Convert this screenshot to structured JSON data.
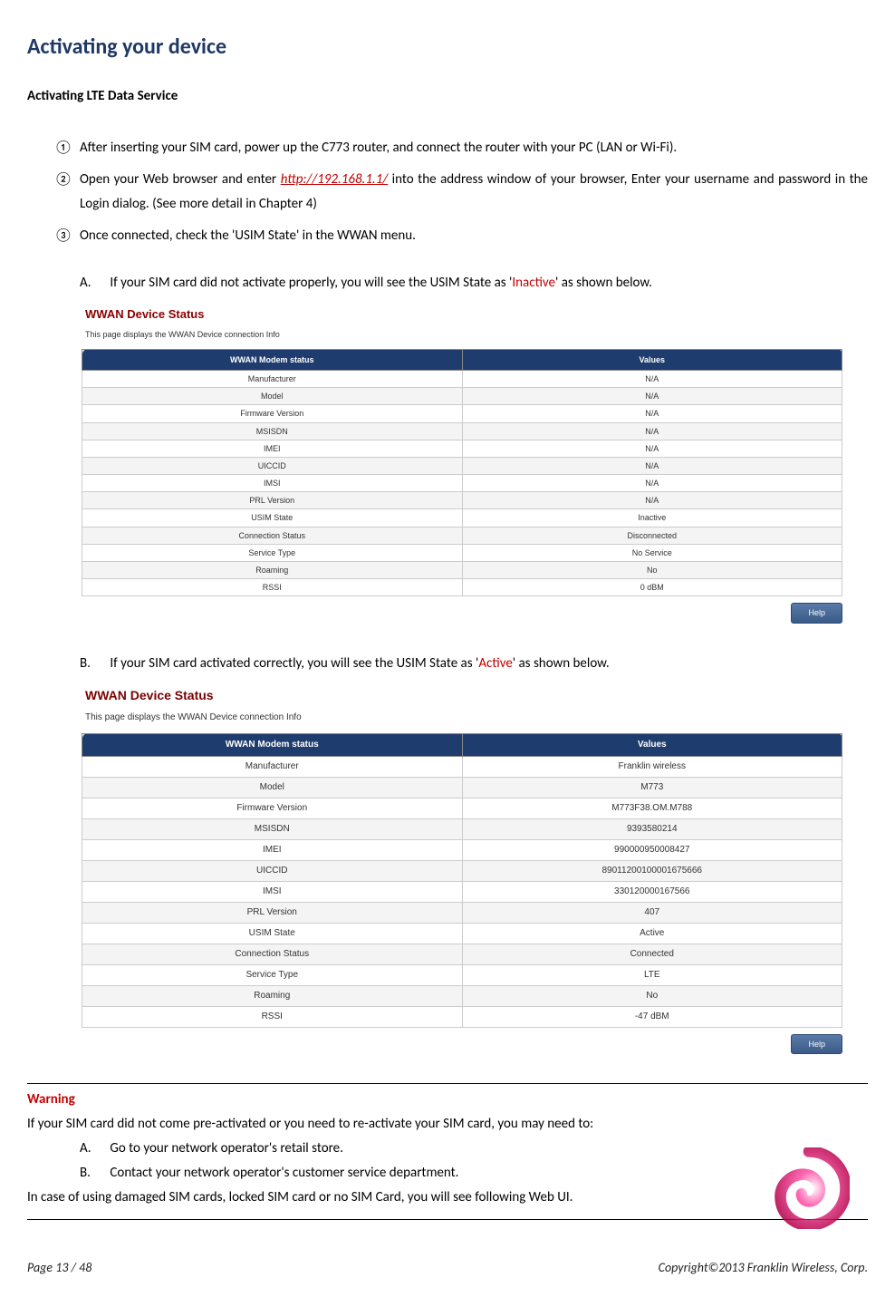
{
  "title": "Activating your device",
  "subheading": "Activating LTE Data Service",
  "steps": {
    "s1_num": "①",
    "s1": "After inserting your SIM card, power up the C773 router, and connect the router with your PC (LAN or Wi-Fi).",
    "s2_num": "②",
    "s2_pre": "Open your Web browser and enter ",
    "s2_link": "http://192.168.1.1/",
    "s2_post": " into the address window of your browser, Enter your username and password in the Login dialog. (See more detail in Chapter 4)",
    "s3_num": "③",
    "s3": "Once connected, check the 'USIM State' in the WWAN menu."
  },
  "caseA": {
    "label": "A.",
    "text_pre": "If your SIM card did not activate properly, you will see the USIM State as '",
    "state": "Inactive",
    "text_post": "' as shown below."
  },
  "caseB": {
    "label": "B.",
    "text_pre": "If your SIM card activated correctly, you will see the USIM State as '",
    "state": "Active",
    "text_post": "' as shown below."
  },
  "ssA": {
    "title": "WWAN Device Status",
    "sub": "This page displays the WWAN Device connection Info",
    "th1": "WWAN Modem status",
    "th2": "Values",
    "rows": [
      {
        "k": "Manufacturer",
        "v": "N/A"
      },
      {
        "k": "Model",
        "v": "N/A"
      },
      {
        "k": "Firmware Version",
        "v": "N/A"
      },
      {
        "k": "MSISDN",
        "v": "N/A"
      },
      {
        "k": "IMEI",
        "v": "N/A"
      },
      {
        "k": "UICCID",
        "v": "N/A"
      },
      {
        "k": "IMSI",
        "v": "N/A"
      },
      {
        "k": "PRL Version",
        "v": "N/A"
      },
      {
        "k": "USIM State",
        "v": "Inactive"
      },
      {
        "k": "Connection Status",
        "v": "Disconnected"
      },
      {
        "k": "Service Type",
        "v": "No Service"
      },
      {
        "k": "Roaming",
        "v": "No"
      },
      {
        "k": "RSSI",
        "v": "0 dBM"
      }
    ],
    "help": "Help"
  },
  "ssB": {
    "title": "WWAN Device Status",
    "sub": "This page displays the WWAN Device connection Info",
    "th1": "WWAN Modem status",
    "th2": "Values",
    "rows": [
      {
        "k": "Manufacturer",
        "v": "Franklin wireless"
      },
      {
        "k": "Model",
        "v": "M773"
      },
      {
        "k": "Firmware Version",
        "v": "M773F38.OM.M788"
      },
      {
        "k": "MSISDN",
        "v": "9393580214"
      },
      {
        "k": "IMEI",
        "v": "990000950008427"
      },
      {
        "k": "UICCID",
        "v": "89011200100001675666"
      },
      {
        "k": "IMSI",
        "v": "330120000167566"
      },
      {
        "k": "PRL Version",
        "v": "407"
      },
      {
        "k": "USIM State",
        "v": "Active"
      },
      {
        "k": "Connection Status",
        "v": "Connected"
      },
      {
        "k": "Service Type",
        "v": "LTE"
      },
      {
        "k": "Roaming",
        "v": "No"
      },
      {
        "k": "RSSI",
        "v": "-47 dBM"
      }
    ],
    "help": "Help"
  },
  "warning": {
    "title": "Warning",
    "intro": "If your SIM card did not come pre-activated or you need to re-activate your SIM card, you may need to:",
    "a_label": "A.",
    "a": "Go to your network operator's retail store.",
    "b_label": "B.",
    "b": "Contact your network operator's customer service department.",
    "outro": "In case of using damaged SIM cards, locked SIM card or no SIM Card, you will see following Web UI."
  },
  "footer": {
    "left": "Page  13  /  48",
    "right": "Copyright©2013  Franklin  Wireless, Corp."
  }
}
